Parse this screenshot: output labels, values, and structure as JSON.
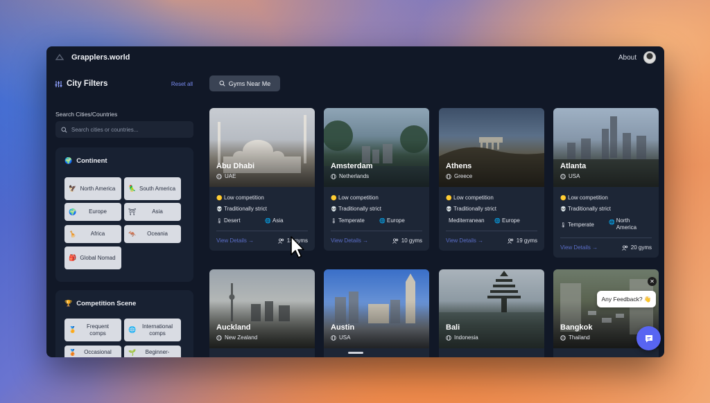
{
  "header": {
    "brand": "Grapplers.world",
    "about": "About"
  },
  "sidebar": {
    "title": "City Filters",
    "reset": "Reset all",
    "search_label": "Search Cities/Countries",
    "search_placeholder": "Search cities or countries...",
    "continent": {
      "title": "Continent",
      "icon": "globe-icon",
      "chips": [
        {
          "label": "North America",
          "icon": "eagle-icon"
        },
        {
          "label": "South America",
          "icon": "parrot-icon"
        },
        {
          "label": "Europe",
          "icon": "globe-europe-icon"
        },
        {
          "label": "Asia",
          "icon": "temple-icon"
        },
        {
          "label": "Africa",
          "icon": "giraffe-icon"
        },
        {
          "label": "Oceania",
          "icon": "kangaroo-icon"
        },
        {
          "label": "Global Nomad",
          "icon": "backpack-icon"
        }
      ]
    },
    "competition": {
      "title": "Competition Scene",
      "icon": "trophy-icon",
      "chips": [
        {
          "label": "Frequent comps",
          "icon": "medal-icon"
        },
        {
          "label": "International comps",
          "icon": "globe-icon"
        },
        {
          "label": "Occasional",
          "icon": "medal-icon"
        },
        {
          "label": "Beginner-",
          "icon": "seedling-icon"
        }
      ]
    }
  },
  "main": {
    "gyms_near_me": "Gyms Near Me",
    "details_label": "View Details →",
    "cities": [
      {
        "name": "Abu Dhabi",
        "country": "UAE",
        "competition": "Low competition",
        "culture": "Traditionally strict",
        "climate": "Desert",
        "continent": "Asia",
        "gyms": "13 gyms"
      },
      {
        "name": "Amsterdam",
        "country": "Netherlands",
        "competition": "Low competition",
        "culture": "Traditionally strict",
        "climate": "Temperate",
        "continent": "Europe",
        "gyms": "10 gyms"
      },
      {
        "name": "Athens",
        "country": "Greece",
        "competition": "Low competition",
        "culture": "Traditionally strict",
        "climate": "Mediterranean",
        "continent": "Europe",
        "gyms": "19 gyms"
      },
      {
        "name": "Atlanta",
        "country": "USA",
        "competition": "Low competition",
        "culture": "Traditionally strict",
        "climate": "Temperate",
        "continent": "North America",
        "gyms": "20 gyms"
      },
      {
        "name": "Auckland",
        "country": "New Zealand"
      },
      {
        "name": "Austin",
        "country": "USA"
      },
      {
        "name": "Bali",
        "country": "Indonesia"
      },
      {
        "name": "Bangkok",
        "country": "Thailand"
      }
    ]
  },
  "widgets": {
    "feedback": "Any Feedback? 👋"
  },
  "colors": {
    "accent": "#5865f2",
    "link": "#5b6ec8",
    "background": "#111827",
    "card": "#1d2636"
  }
}
